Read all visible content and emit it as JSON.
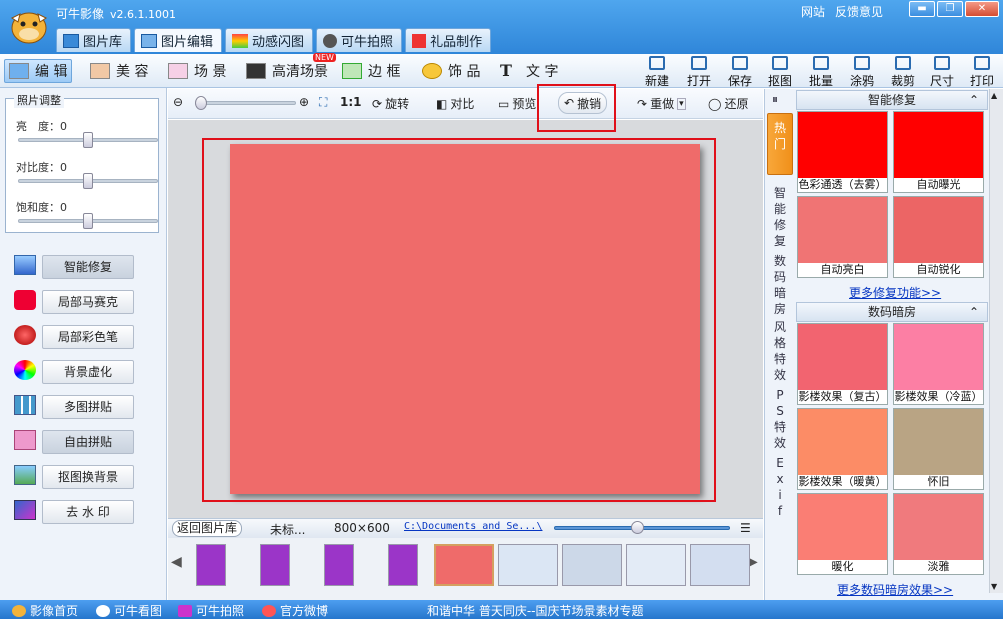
{
  "app": {
    "title": "可牛影像",
    "version": "v2.6.1.1001"
  },
  "toplinks": [
    "网站",
    "反馈意见"
  ],
  "window_controls": [
    "▬",
    "❐",
    "✕"
  ],
  "tabs": [
    {
      "label": "图片库",
      "icon": "photo-library-icon"
    },
    {
      "label": "图片编辑",
      "icon": "edit-icon",
      "active": true
    },
    {
      "label": "动感闪图",
      "icon": "flash-icon"
    },
    {
      "label": "可牛拍照",
      "icon": "webcam-icon"
    },
    {
      "label": "礼品制作",
      "icon": "gift-icon"
    }
  ],
  "modes": [
    {
      "label": "编 辑",
      "active": true
    },
    {
      "label": "美 容"
    },
    {
      "label": "场 景"
    },
    {
      "label": "高清场景",
      "badge": "NEW"
    },
    {
      "label": "边 框"
    },
    {
      "label": "饰 品"
    },
    {
      "label": "文 字"
    }
  ],
  "toolbar_buttons": [
    "新建",
    "打开",
    "保存",
    "抠图",
    "批量",
    "涂鸦",
    "裁剪",
    "尺寸",
    "打印"
  ],
  "adjust": {
    "title": "照片调整",
    "brightness_label": "亮　度：",
    "brightness_value": "0",
    "contrast_label": "对比度：",
    "contrast_value": "0",
    "saturation_label": "饱和度：",
    "saturation_value": "0"
  },
  "functions": [
    "智能修复",
    "局部马赛克",
    "局部彩色笔",
    "背景虚化",
    "多图拼贴",
    "自由拼贴",
    "抠图换背景",
    "去 水 印"
  ],
  "centerbar": {
    "ratio": "1:1",
    "rotate": "旋转",
    "compare": "对比",
    "preview": "预览",
    "undo": "撤销",
    "redo": "重做",
    "restore": "还原"
  },
  "status": {
    "back": "返回图片库",
    "filename": "未标...",
    "size": "800×600",
    "path": "C:\\Documents and Se...\\"
  },
  "photo_color": "#ef6b6a",
  "thumbs": [
    {
      "bg": "#9b35c8"
    },
    {
      "bg": "#9b35c8"
    },
    {
      "bg": "#9b35c8"
    },
    {
      "bg": "#9b35c8"
    },
    {
      "bg": "#ef6b6a",
      "selected": true
    },
    {
      "bg": "#dbe6f4"
    },
    {
      "bg": "#ccd8e8"
    },
    {
      "bg": "#e3ebf6"
    },
    {
      "bg": "#d3def0"
    }
  ],
  "right": {
    "vtabs": [
      "热\n门",
      "智\n能\n修\n复",
      "数\n码\n暗\n房",
      "风\n格\n特\n效",
      "P\nS\n特\n效",
      "E\nx\ni\nf"
    ],
    "section1": "智能修复",
    "section2": "数码暗房",
    "repair": [
      {
        "label": "色彩通透（去雾）",
        "color": "#ff0000"
      },
      {
        "label": "自动曝光",
        "color": "#ff0000"
      },
      {
        "label": "自动亮白",
        "color": "#f07474"
      },
      {
        "label": "自动锐化",
        "color": "#ec6565"
      }
    ],
    "more_repair": "更多修复功能>>",
    "darkroom": [
      {
        "label": "影楼效果（复古）",
        "color": "#f26470"
      },
      {
        "label": "影楼效果（冷蓝）",
        "color": "#fc7fa4"
      },
      {
        "label": "影楼效果（暖黄）",
        "color": "#fc8c66"
      },
      {
        "label": "怀旧",
        "color": "#b9a484"
      },
      {
        "label": "暖化",
        "color": "#fa7e74"
      },
      {
        "label": "淡雅",
        "color": "#f07a7d"
      }
    ],
    "more_darkroom": "更多数码暗房效果>>"
  },
  "bottom": {
    "items": [
      "影像首页",
      "可牛看图",
      "可牛拍照",
      "官方微博"
    ],
    "marquee": "和谐中华  普天同庆--国庆节场景素材专题"
  }
}
